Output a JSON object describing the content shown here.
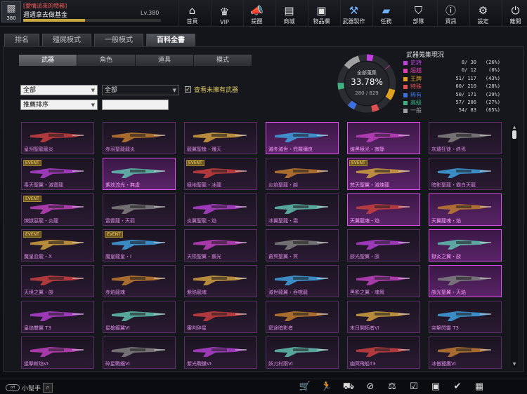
{
  "player": {
    "title": "[愛情派來的特務]",
    "name": "週週拿去做基金",
    "level": "Lv.380",
    "avatar_level": "380",
    "exp_progress": 0.45
  },
  "nav": [
    {
      "label": "首頁",
      "icon": "home-icon",
      "glyph": "⌂",
      "blue": false
    },
    {
      "label": "VIP",
      "icon": "crown-icon",
      "glyph": "♛",
      "blue": false
    },
    {
      "label": "提醒",
      "icon": "megaphone-icon",
      "glyph": "📣",
      "blue": true
    },
    {
      "label": "商城",
      "icon": "shop-icon",
      "glyph": "▤",
      "blue": false
    },
    {
      "label": "物品欄",
      "icon": "bag-icon",
      "glyph": "▣",
      "blue": false
    },
    {
      "label": "武器製作",
      "icon": "craft-icon",
      "glyph": "⚒",
      "blue": true
    },
    {
      "label": "任務",
      "icon": "ticket-icon",
      "glyph": "▰",
      "blue": true
    },
    {
      "label": "部隊",
      "icon": "shield-icon",
      "glyph": "⛉",
      "blue": false
    },
    {
      "label": "資訊",
      "icon": "info-icon",
      "glyph": "ⓘ",
      "blue": false
    },
    {
      "label": "設定",
      "icon": "gear-icon",
      "glyph": "⚙",
      "blue": false
    },
    {
      "label": "離開",
      "icon": "power-icon",
      "glyph": "⏻",
      "blue": false
    }
  ],
  "tabs": [
    "排名",
    "殭屍模式",
    "一般模式",
    "百科全書"
  ],
  "subtabs": [
    "武器",
    "角色",
    "道具",
    "模式"
  ],
  "filters": {
    "category": "全部",
    "category2": "全部",
    "sort": "推薦排序",
    "owned_label": "查看未擁有武器",
    "search": ""
  },
  "collection": {
    "label": "全部蒐集",
    "percent": "33.78%",
    "count": "280 / 829",
    "title": "武器蒐集現況"
  },
  "stats": [
    {
      "name": "史詩",
      "count": "8/  30",
      "pct": "(26%)",
      "color": "#c040e0",
      "fraction": 0.26
    },
    {
      "name": "超越",
      "count": "0/  12",
      "pct": "(0%)",
      "color": "#e040b0",
      "fraction": 0.0
    },
    {
      "name": "王牌",
      "count": "51/ 117",
      "pct": "(43%)",
      "color": "#e0a020",
      "fraction": 0.43
    },
    {
      "name": "特殊",
      "count": "60/ 210",
      "pct": "(28%)",
      "color": "#e05050",
      "fraction": 0.28
    },
    {
      "name": "稀有",
      "count": "50/ 171",
      "pct": "(29%)",
      "color": "#4070e0",
      "fraction": 0.29
    },
    {
      "name": "高級",
      "count": "57/ 206",
      "pct": "(27%)",
      "color": "#40b080",
      "fraction": 0.27
    },
    {
      "name": "一般",
      "count": "54/  83",
      "pct": "(65%)",
      "color": "#a0a0a0",
      "fraction": 0.65
    }
  ],
  "weapons": [
    {
      "name": "皇翎聖龍龍炎",
      "hl": false,
      "event": false
    },
    {
      "name": "赤羽聖龍龍炎",
      "hl": false,
      "event": false
    },
    {
      "name": "龍翼聖槍・殲天",
      "hl": false,
      "event": false
    },
    {
      "name": "滅冬滅世・兜羅彌良",
      "hl": true,
      "event": false
    },
    {
      "name": "煌黑極光・寂靜",
      "hl": true,
      "event": false
    },
    {
      "name": "灰燼狂徒・終焉",
      "hl": false,
      "event": false
    },
    {
      "name": "毒天聖翼・滅寶龍",
      "hl": false,
      "event": true
    },
    {
      "name": "紫炫流光・無虛",
      "hl": true,
      "event": false
    },
    {
      "name": "極地聖龍・冰龍",
      "hl": false,
      "event": true
    },
    {
      "name": "炎焰聖龍・燄",
      "hl": false,
      "event": false
    },
    {
      "name": "梵天聖翼・滅煉龍",
      "hl": true,
      "event": true
    },
    {
      "name": "暗影聖龍・霸白天龍",
      "hl": false,
      "event": false
    },
    {
      "name": "煉獄惡龍・炎龍",
      "hl": false,
      "event": true
    },
    {
      "name": "雷霆龍・天罰",
      "hl": false,
      "event": false
    },
    {
      "name": "炎翼聖龍・焰",
      "hl": false,
      "event": false
    },
    {
      "name": "冰翼聖龍・霜",
      "hl": false,
      "event": false
    },
    {
      "name": "天翼龍魂・焰",
      "hl": true,
      "event": false
    },
    {
      "name": "天翼龍魂・焰",
      "hl": true,
      "event": false
    },
    {
      "name": "魔皇血龍・Ⅹ",
      "hl": false,
      "event": true
    },
    {
      "name": "魔皇龍皇・Ⅰ",
      "hl": false,
      "event": true
    },
    {
      "name": "天陨聖翼・霸光",
      "hl": false,
      "event": false
    },
    {
      "name": "蒼冥聖翼・冥",
      "hl": false,
      "event": false
    },
    {
      "name": "燄光聖翼・燄",
      "hl": false,
      "event": false
    },
    {
      "name": "獄炎之翼・燄",
      "hl": true,
      "event": false
    },
    {
      "name": "天境之翼・燄",
      "hl": false,
      "event": false
    },
    {
      "name": "赤焰龍魂",
      "hl": false,
      "event": false
    },
    {
      "name": "紫焰龍魂",
      "hl": false,
      "event": false
    },
    {
      "name": "滅世龍翼・吞噬龍",
      "hl": false,
      "event": false
    },
    {
      "name": "黑影之翼・魂殤",
      "hl": false,
      "event": false
    },
    {
      "name": "燄光聖翼・天焰",
      "hl": true,
      "event": false
    },
    {
      "name": "皇焰雙翼 T3",
      "hl": false,
      "event": false
    },
    {
      "name": "星槍鍍翼VI",
      "hl": false,
      "event": false
    },
    {
      "name": "審判碎星",
      "hl": false,
      "event": false
    },
    {
      "name": "窮途暗影者",
      "hl": false,
      "event": false
    },
    {
      "name": "末日開拓者VI",
      "hl": false,
      "event": false
    },
    {
      "name": "突擊閃靈 T3",
      "hl": false,
      "event": false
    },
    {
      "name": "狙擊斬焰VI",
      "hl": false,
      "event": false
    },
    {
      "name": "碎星戰鋸VI",
      "hl": false,
      "event": false
    },
    {
      "name": "紫光戰鎌VI",
      "hl": false,
      "event": false
    },
    {
      "name": "妖刀村雨VI",
      "hl": false,
      "event": false
    },
    {
      "name": "幽冥飛船T3",
      "hl": false,
      "event": false
    },
    {
      "name": "冰傲獵鷹VI",
      "hl": false,
      "event": false
    }
  ],
  "helper_label": "小幫手",
  "helper_pill": "off",
  "bottom_icons": [
    "shop-cart-icon",
    "runner-icon",
    "cart-icon",
    "compass-icon",
    "balance-icon",
    "checklist-icon",
    "frame-icon",
    "calendar-check-icon",
    "film-icon"
  ],
  "bottom_glyphs": [
    "🛒",
    "🏃",
    "⛟",
    "⊘",
    "⚖",
    "☑",
    "▣",
    "✔",
    "▦"
  ]
}
